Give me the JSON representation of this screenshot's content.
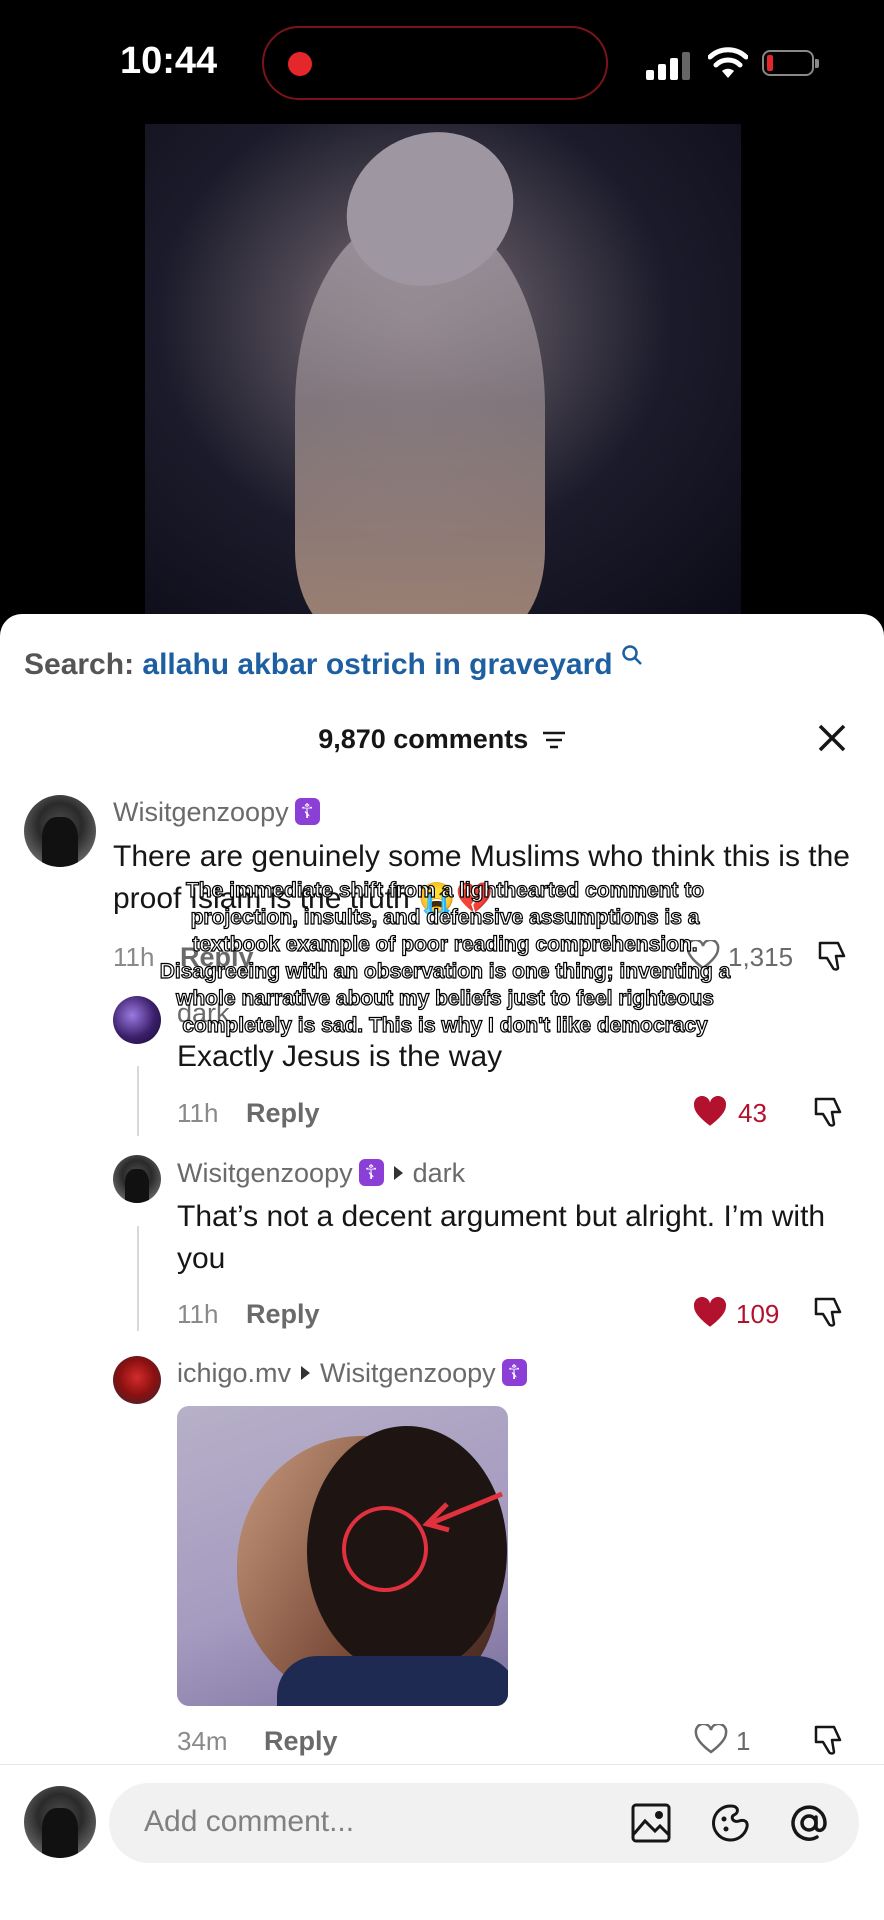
{
  "status_bar": {
    "time": "10:44"
  },
  "search": {
    "label": "Search:",
    "query": "allahu akbar ostrich in graveyard"
  },
  "comments_header": {
    "count_label": "9,870 comments"
  },
  "overlay_caption": "The immediate shift from a lighthearted comment to projection, insults, and defensive assumptions is a textbook example of poor reading comprehension. Disagreeing with an observation is one thing; inventing a whole narrative about my beliefs just to feel righteous completely is sad. This is why I don't like democracy",
  "comments": [
    {
      "username": "Wisitgenzoopy",
      "badge": "☦",
      "text": "There are genuinely some Muslims who think this is the proof Islam is the truth 😭💔",
      "time": "11h",
      "reply_label": "Reply",
      "likes": "1,315",
      "liked": false
    },
    {
      "username": "dark",
      "text": "Exactly Jesus is the way",
      "time": "11h",
      "reply_label": "Reply",
      "likes": "43",
      "liked": true
    },
    {
      "username": "Wisitgenzoopy",
      "badge": "☦",
      "reply_to": "dark",
      "text": "That’s not a decent argument but alright. I’m with you",
      "time": "11h",
      "reply_label": "Reply",
      "likes": "109",
      "liked": true
    },
    {
      "username": "ichigo.mv",
      "reply_to": "Wisitgenzoopy",
      "reply_to_badge": "☦",
      "time": "34m",
      "reply_label": "Reply",
      "likes": "1",
      "liked": false
    }
  ],
  "input": {
    "placeholder": "Add comment..."
  },
  "colors": {
    "link_blue": "#1d5fa0",
    "like_red": "#b3122e",
    "badge_purple": "#8b3fd6"
  },
  "icons": [
    "search-icon",
    "filter-icon",
    "close-icon",
    "heart-icon",
    "dislike-icon",
    "image-icon",
    "emoji-icon",
    "mention-icon"
  ]
}
